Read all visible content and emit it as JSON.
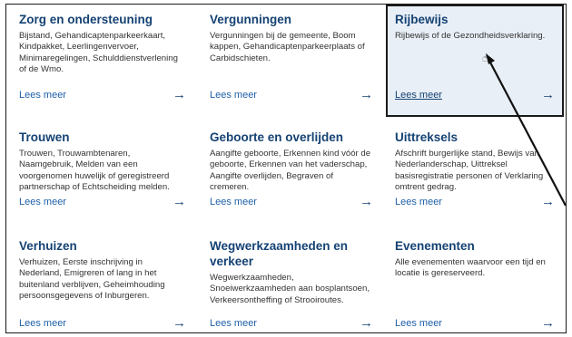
{
  "cards": [
    {
      "title": "Zorg en ondersteuning",
      "description": "Bijstand, Gehandicaptenparkeerkaart, Kindpakket, Leerlingenvervoer, Minimaregelingen, Schulddienstverlening of de Wmo.",
      "link_label": "Lees meer",
      "arrow": "→"
    },
    {
      "title": "Vergunningen",
      "description": "Vergunningen bij de gemeente, Boom kappen, Gehandicaptenparkeerplaats of Carbidschieten.",
      "link_label": "Lees meer",
      "arrow": "→"
    },
    {
      "title": "Rijbewijs",
      "description": "Rijbewijs of de Gezondheidsverklaring.",
      "link_label": "Lees meer",
      "arrow": "→"
    },
    {
      "title": "Trouwen",
      "description": "Trouwen, Trouwambtenaren, Naamgebruik, Melden van een voorgenomen huwelijk of geregistreerd partnerschap of Echtscheiding melden.",
      "link_label": "Lees meer",
      "arrow": "→"
    },
    {
      "title": "Geboorte en overlijden",
      "description": "Aangifte geboorte, Erkennen kind vóór de geboorte, Erkennen van het vaderschap, Aangifte overlijden, Begraven of cremeren.",
      "link_label": "Lees meer",
      "arrow": "→"
    },
    {
      "title": "Uittreksels",
      "description": "Afschrift burgerlijke stand, Bewijs van Nederlanderschap, Uittreksel basisregistratie personen of Verklaring omtrent gedrag.",
      "link_label": "Lees meer",
      "arrow": "→"
    },
    {
      "title": "Verhuizen",
      "description": "Verhuizen, Eerste inschrijving in Nederland, Emigreren of lang in het buitenland verblijven, Geheimhouding persoonsgegevens of Inburgeren.",
      "link_label": "Lees meer",
      "arrow": "→"
    },
    {
      "title": "Wegwerkzaamheden en verkeer",
      "description": "Wegwerkzaamheden, Snoeiwerkzaamheden aan bosplantsoen, Verkeersontheffing of Strooiroutes.",
      "link_label": "Lees meer",
      "arrow": "→"
    },
    {
      "title": "Evenementen",
      "description": "Alle evenementen waarvoor een tijd en locatie is gereserveerd.",
      "link_label": "Lees meer",
      "arrow": "→"
    }
  ],
  "cursor_icon": "hand-pointer-icon",
  "colors": {
    "title": "#154273",
    "link": "#1f60a8",
    "highlight_bg": "#e8eff6"
  }
}
